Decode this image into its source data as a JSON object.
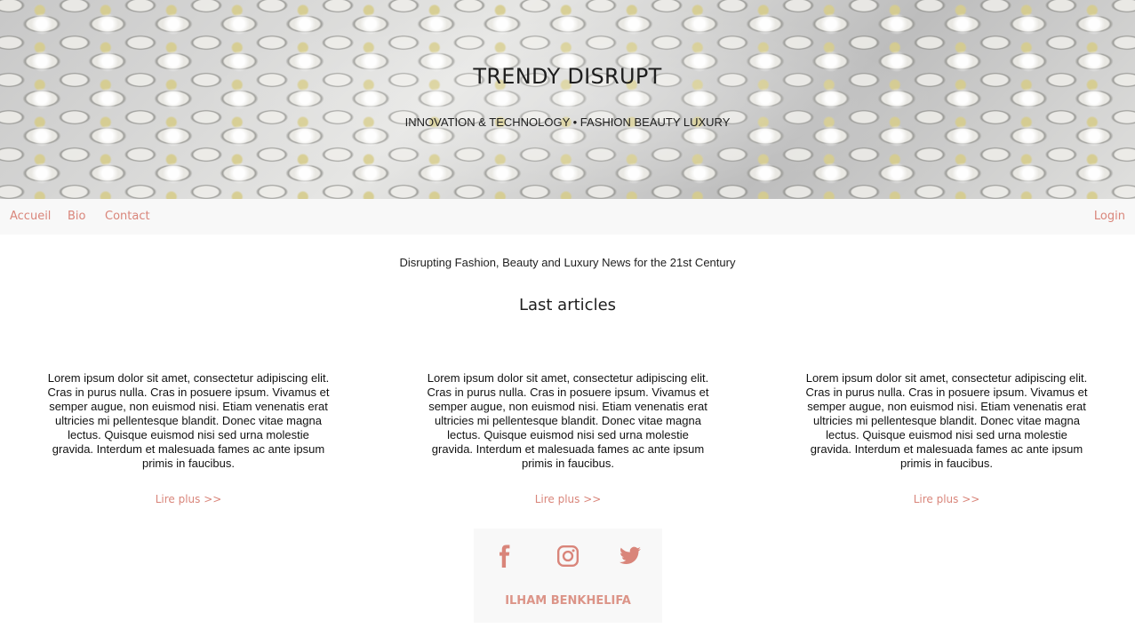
{
  "hero": {
    "title": "TRENDY DISRUPT",
    "subtitle": "INNOVATION & TECHNOLOGY • FASHION BEAUTY LUXURY"
  },
  "nav": {
    "items": [
      {
        "label": "Accueil"
      },
      {
        "label": "Bio"
      },
      {
        "label": "Contact"
      }
    ],
    "login_label": "Login"
  },
  "tagline": "Disrupting Fashion, Beauty and Luxury News for the 21st Century",
  "section_title": "Last articles",
  "articles": [
    {
      "text": "Lorem ipsum dolor sit amet, consectetur adipiscing elit. Cras in purus nulla. Cras in posuere ipsum. Vivamus et semper augue, non euismod nisi. Etiam venenatis erat ultricies mi pellentesque blandit. Donec vitae magna lectus. Quisque euismod nisi sed urna molestie gravida. Interdum et malesuada fames ac ante ipsum primis in faucibus.",
      "link_label": "Lire plus >>"
    },
    {
      "text": "Lorem ipsum dolor sit amet, consectetur adipiscing elit. Cras in purus nulla. Cras in posuere ipsum. Vivamus et semper augue, non euismod nisi. Etiam venenatis erat ultricies mi pellentesque blandit. Donec vitae magna lectus. Quisque euismod nisi sed urna molestie gravida. Interdum et malesuada fames ac ante ipsum primis in faucibus.",
      "link_label": "Lire plus >>"
    },
    {
      "text": "Lorem ipsum dolor sit amet, consectetur adipiscing elit. Cras in purus nulla. Cras in posuere ipsum. Vivamus et semper augue, non euismod nisi. Etiam venenatis erat ultricies mi pellentesque blandit. Donec vitae magna lectus. Quisque euismod nisi sed urna molestie gravida. Interdum et malesuada fames ac ante ipsum primis in faucibus.",
      "link_label": "Lire plus >>"
    }
  ],
  "footer": {
    "social_icons": [
      "facebook-icon",
      "instagram-icon",
      "twitter-icon"
    ],
    "author": "ILHAM BENKHELIFA"
  },
  "colors": {
    "accent": "#d9857a",
    "nav_background": "#f8f8f8"
  }
}
